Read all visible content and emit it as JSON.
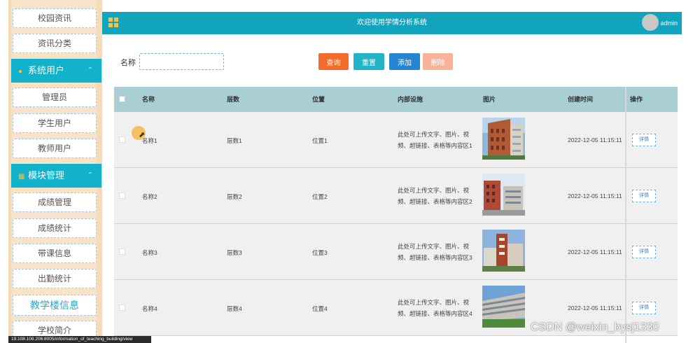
{
  "header": {
    "title": "欢迎使用学情分析系统",
    "username": "admin"
  },
  "sidebar": {
    "items_top": [
      {
        "label": "校园资讯"
      },
      {
        "label": "资讯分类"
      }
    ],
    "group_users": {
      "label": "系统用户",
      "items": [
        {
          "label": "管理员"
        },
        {
          "label": "学生用户"
        },
        {
          "label": "教师用户"
        }
      ]
    },
    "group_modules": {
      "label": "模块管理",
      "items": [
        {
          "label": "成绩管理"
        },
        {
          "label": "成绩统计"
        },
        {
          "label": "带课信息"
        },
        {
          "label": "出勤统计"
        },
        {
          "label": "教学楼信息"
        },
        {
          "label": "学校简介"
        }
      ]
    }
  },
  "search": {
    "label": "名称",
    "value": "",
    "placeholder": ""
  },
  "toolbar": {
    "query_label": "查询",
    "reset_label": "重置",
    "add_label": "添加",
    "delete_label": "删除"
  },
  "table": {
    "headers": [
      "名称",
      "层数",
      "位置",
      "内部设施",
      "图片",
      "创建时间",
      "操作"
    ],
    "rows": [
      {
        "name": "名称1",
        "floors": "层数1",
        "location": "位置1",
        "facilities_1": "此处可上传文字、图片、视",
        "facilities_2": "频、超链接、表格等内容区1",
        "created": "2022-12-05 11:15:11",
        "action": "详情"
      },
      {
        "name": "名称2",
        "floors": "层数2",
        "location": "位置2",
        "facilities_1": "此处可上传文字、图片、视",
        "facilities_2": "频、超链接、表格等内容区2",
        "created": "2022-12-05 11:15:11",
        "action": "详情"
      },
      {
        "name": "名称3",
        "floors": "层数3",
        "location": "位置3",
        "facilities_1": "此处可上传文字、图片、视",
        "facilities_2": "频、超链接、表格等内容区3",
        "created": "2022-12-05 11:15:11",
        "action": "详情"
      },
      {
        "name": "名称4",
        "floors": "层数4",
        "location": "位置4",
        "facilities_1": "此处可上传文字、图片、视",
        "facilities_2": "频、超链接、表格等内容区4",
        "created": "2022-12-05 11:15:11",
        "action": "详情"
      }
    ]
  },
  "statusbar": {
    "url": "19.108.108.206:8005/information_of_teaching_building/view"
  },
  "watermark": "CSDN @weixin_bysj1330",
  "colors": {
    "header": "#12a4bd",
    "sidebar_group": "#12b1cc",
    "sidebar_bg": "#f7e3c7",
    "query": "#f26d2b",
    "reset": "#22b3c8",
    "add": "#2586cf",
    "delete": "#f7b39a"
  }
}
